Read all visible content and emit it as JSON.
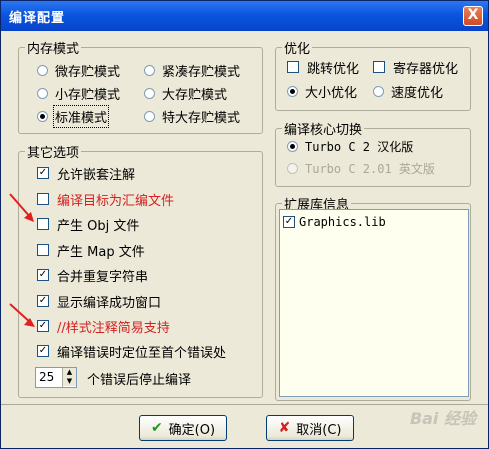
{
  "window": {
    "title": "编译配置",
    "close_label": "X"
  },
  "memory": {
    "legend": "内存模式",
    "options": [
      "微存贮模式",
      "紧凑存贮模式",
      "小存贮模式",
      "大存贮模式",
      "标准模式",
      "特大存贮模式"
    ],
    "selected": "标准模式"
  },
  "other": {
    "legend": "其它选项",
    "items": [
      {
        "label": "允许嵌套注解",
        "checked": true
      },
      {
        "label": "编译目标为汇编文件",
        "checked": false
      },
      {
        "label": "产生 Obj 文件",
        "checked": false
      },
      {
        "label": "产生 Map 文件",
        "checked": false
      },
      {
        "label": "合并重复字符串",
        "checked": true
      },
      {
        "label": "显示编译成功窗口",
        "checked": true
      },
      {
        "label": "//样式注释简易支持",
        "checked": true
      },
      {
        "label": "编译错误时定位至首个错误处",
        "checked": true
      }
    ],
    "error_count": "25",
    "error_label": "个错误后停止编译"
  },
  "optimize": {
    "legend": "优化",
    "jump": "跳转优化",
    "register": "寄存器优化",
    "size": "大小优化",
    "speed": "速度优化",
    "selected": "大小优化"
  },
  "core": {
    "legend": "编译核心切换",
    "tc2": "Turbo C 2 汉化版",
    "tc201": "Turbo C 2.01 英文版"
  },
  "libs": {
    "legend": "扩展库信息",
    "items": [
      {
        "label": "Graphics.lib",
        "checked": true
      }
    ]
  },
  "buttons": {
    "ok": "确定(O)",
    "cancel": "取消(C)"
  },
  "watermark": "Bai 经验",
  "colors": {
    "titlebar": "#0a55e0",
    "highlight_text": "#d42020",
    "annotation_arrow": "#e02020"
  }
}
